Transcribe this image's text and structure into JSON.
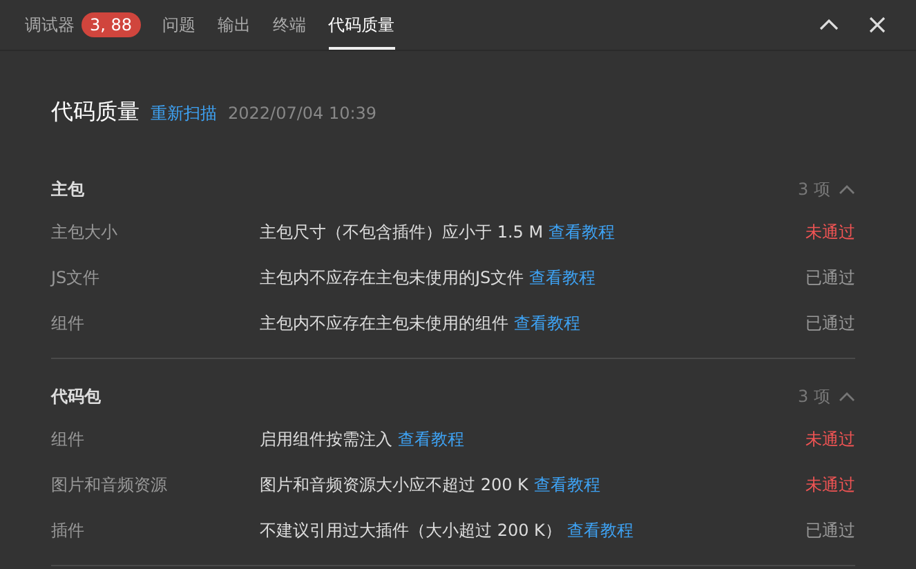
{
  "tabs": [
    {
      "label": "调试器",
      "badge": "3, 88",
      "selected": false
    },
    {
      "label": "问题",
      "selected": false
    },
    {
      "label": "输出",
      "selected": false
    },
    {
      "label": "终端",
      "selected": false
    },
    {
      "label": "代码质量",
      "selected": true
    }
  ],
  "header": {
    "title": "代码质量",
    "rescan": "重新扫描",
    "time": "2022/07/04 10:39"
  },
  "sections": [
    {
      "title": "主包",
      "count": "3 项",
      "expanded": true,
      "items": [
        {
          "name": "主包大小",
          "rule": "主包尺寸（不包含插件）应小于 1.5 M",
          "link": "查看教程",
          "status": "未通过",
          "passed": false
        },
        {
          "name": "JS文件",
          "rule": "主包内不应存在主包未使用的JS文件",
          "link": "查看教程",
          "status": "已通过",
          "passed": true
        },
        {
          "name": "组件",
          "rule": "主包内不应存在主包未使用的组件",
          "link": "查看教程",
          "status": "已通过",
          "passed": true
        }
      ]
    },
    {
      "title": "代码包",
      "count": "3 项",
      "expanded": true,
      "items": [
        {
          "name": "组件",
          "rule": "启用组件按需注入",
          "link": "查看教程",
          "status": "未通过",
          "passed": false
        },
        {
          "name": "图片和音频资源",
          "rule": "图片和音频资源大小应不超过 200 K",
          "link": "查看教程",
          "status": "未通过",
          "passed": false
        },
        {
          "name": "插件",
          "rule": "不建议引用过大插件（大小超过 200 K）",
          "link": "查看教程",
          "status": "已通过",
          "passed": true
        }
      ]
    }
  ]
}
